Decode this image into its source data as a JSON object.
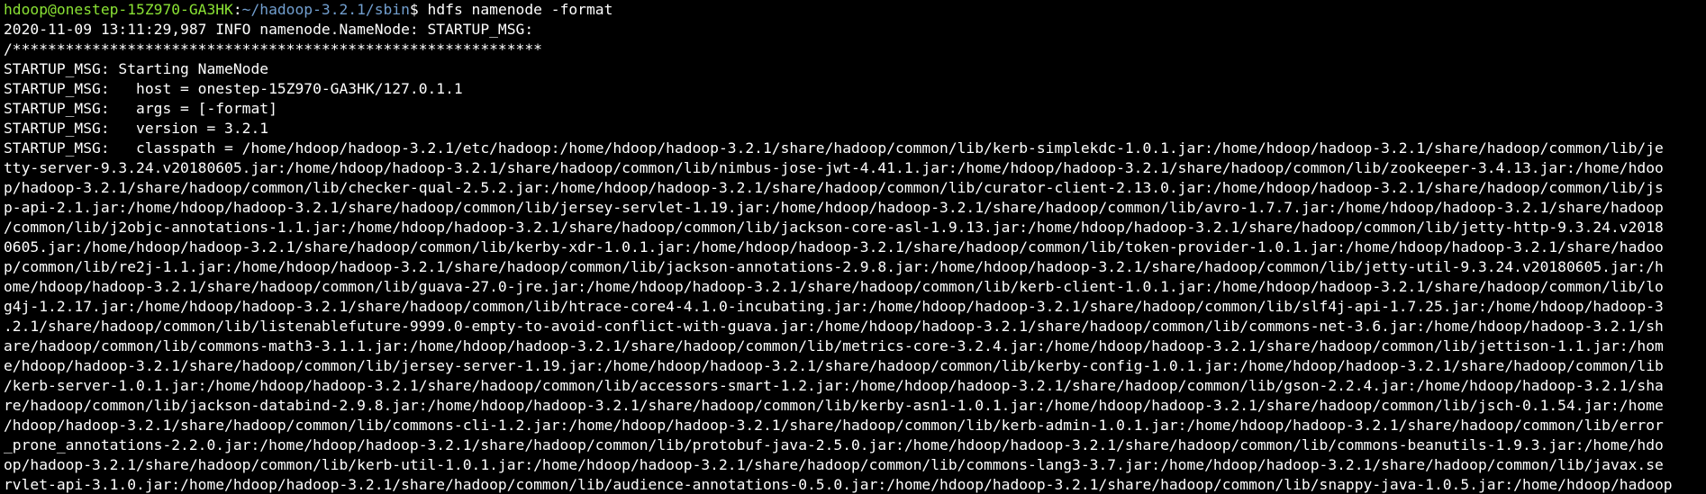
{
  "prompt": {
    "user_host": "hdoop@onestep-15Z970-GA3HK",
    "colon": ":",
    "path": "~/hadoop-3.2.1/sbin",
    "dollar": "$ ",
    "command": "hdfs namenode -format"
  },
  "colors": {
    "background": "#000000",
    "text": "#ffffff",
    "prompt_user": "#8ae234",
    "prompt_path": "#729fcf"
  },
  "lines": [
    "2020-11-09 13:11:29,987 INFO namenode.NameNode: STARTUP_MSG:",
    "/************************************************************",
    "STARTUP_MSG: Starting NameNode",
    "STARTUP_MSG:   host = onestep-15Z970-GA3HK/127.0.1.1",
    "STARTUP_MSG:   args = [-format]",
    "STARTUP_MSG:   version = 3.2.1",
    "STARTUP_MSG:   classpath = /home/hdoop/hadoop-3.2.1/etc/hadoop:/home/hdoop/hadoop-3.2.1/share/hadoop/common/lib/kerb-simplekdc-1.0.1.jar:/home/hdoop/hadoop-3.2.1/share/hadoop/common/lib/je",
    "tty-server-9.3.24.v20180605.jar:/home/hdoop/hadoop-3.2.1/share/hadoop/common/lib/nimbus-jose-jwt-4.41.1.jar:/home/hdoop/hadoop-3.2.1/share/hadoop/common/lib/zookeeper-3.4.13.jar:/home/hdoo",
    "p/hadoop-3.2.1/share/hadoop/common/lib/checker-qual-2.5.2.jar:/home/hdoop/hadoop-3.2.1/share/hadoop/common/lib/curator-client-2.13.0.jar:/home/hdoop/hadoop-3.2.1/share/hadoop/common/lib/js",
    "p-api-2.1.jar:/home/hdoop/hadoop-3.2.1/share/hadoop/common/lib/jersey-servlet-1.19.jar:/home/hdoop/hadoop-3.2.1/share/hadoop/common/lib/avro-1.7.7.jar:/home/hdoop/hadoop-3.2.1/share/hadoop",
    "/common/lib/j2objc-annotations-1.1.jar:/home/hdoop/hadoop-3.2.1/share/hadoop/common/lib/jackson-core-asl-1.9.13.jar:/home/hdoop/hadoop-3.2.1/share/hadoop/common/lib/jetty-http-9.3.24.v2018",
    "0605.jar:/home/hdoop/hadoop-3.2.1/share/hadoop/common/lib/kerby-xdr-1.0.1.jar:/home/hdoop/hadoop-3.2.1/share/hadoop/common/lib/token-provider-1.0.1.jar:/home/hdoop/hadoop-3.2.1/share/hadoo",
    "p/common/lib/re2j-1.1.jar:/home/hdoop/hadoop-3.2.1/share/hadoop/common/lib/jackson-annotations-2.9.8.jar:/home/hdoop/hadoop-3.2.1/share/hadoop/common/lib/jetty-util-9.3.24.v20180605.jar:/h",
    "ome/hdoop/hadoop-3.2.1/share/hadoop/common/lib/guava-27.0-jre.jar:/home/hdoop/hadoop-3.2.1/share/hadoop/common/lib/kerb-client-1.0.1.jar:/home/hdoop/hadoop-3.2.1/share/hadoop/common/lib/lo",
    "g4j-1.2.17.jar:/home/hdoop/hadoop-3.2.1/share/hadoop/common/lib/htrace-core4-4.1.0-incubating.jar:/home/hdoop/hadoop-3.2.1/share/hadoop/common/lib/slf4j-api-1.7.25.jar:/home/hdoop/hadoop-3",
    ".2.1/share/hadoop/common/lib/listenablefuture-9999.0-empty-to-avoid-conflict-with-guava.jar:/home/hdoop/hadoop-3.2.1/share/hadoop/common/lib/commons-net-3.6.jar:/home/hdoop/hadoop-3.2.1/sh",
    "are/hadoop/common/lib/commons-math3-3.1.1.jar:/home/hdoop/hadoop-3.2.1/share/hadoop/common/lib/metrics-core-3.2.4.jar:/home/hdoop/hadoop-3.2.1/share/hadoop/common/lib/jettison-1.1.jar:/hom",
    "e/hdoop/hadoop-3.2.1/share/hadoop/common/lib/jersey-server-1.19.jar:/home/hdoop/hadoop-3.2.1/share/hadoop/common/lib/kerby-config-1.0.1.jar:/home/hdoop/hadoop-3.2.1/share/hadoop/common/lib",
    "/kerb-server-1.0.1.jar:/home/hdoop/hadoop-3.2.1/share/hadoop/common/lib/accessors-smart-1.2.jar:/home/hdoop/hadoop-3.2.1/share/hadoop/common/lib/gson-2.2.4.jar:/home/hdoop/hadoop-3.2.1/sha",
    "re/hadoop/common/lib/jackson-databind-2.9.8.jar:/home/hdoop/hadoop-3.2.1/share/hadoop/common/lib/kerby-asn1-1.0.1.jar:/home/hdoop/hadoop-3.2.1/share/hadoop/common/lib/jsch-0.1.54.jar:/home",
    "/hdoop/hadoop-3.2.1/share/hadoop/common/lib/commons-cli-1.2.jar:/home/hdoop/hadoop-3.2.1/share/hadoop/common/lib/kerb-admin-1.0.1.jar:/home/hdoop/hadoop-3.2.1/share/hadoop/common/lib/error",
    "_prone_annotations-2.2.0.jar:/home/hdoop/hadoop-3.2.1/share/hadoop/common/lib/protobuf-java-2.5.0.jar:/home/hdoop/hadoop-3.2.1/share/hadoop/common/lib/commons-beanutils-1.9.3.jar:/home/hdo",
    "op/hadoop-3.2.1/share/hadoop/common/lib/kerb-util-1.0.1.jar:/home/hdoop/hadoop-3.2.1/share/hadoop/common/lib/commons-lang3-3.7.jar:/home/hdoop/hadoop-3.2.1/share/hadoop/common/lib/javax.se",
    "rvlet-api-3.1.0.jar:/home/hdoop/hadoop-3.2.1/share/hadoop/common/lib/audience-annotations-0.5.0.jar:/home/hdoop/hadoop-3.2.1/share/hadoop/common/lib/snappy-java-1.0.5.jar:/home/hdoop/hadoop"
  ]
}
